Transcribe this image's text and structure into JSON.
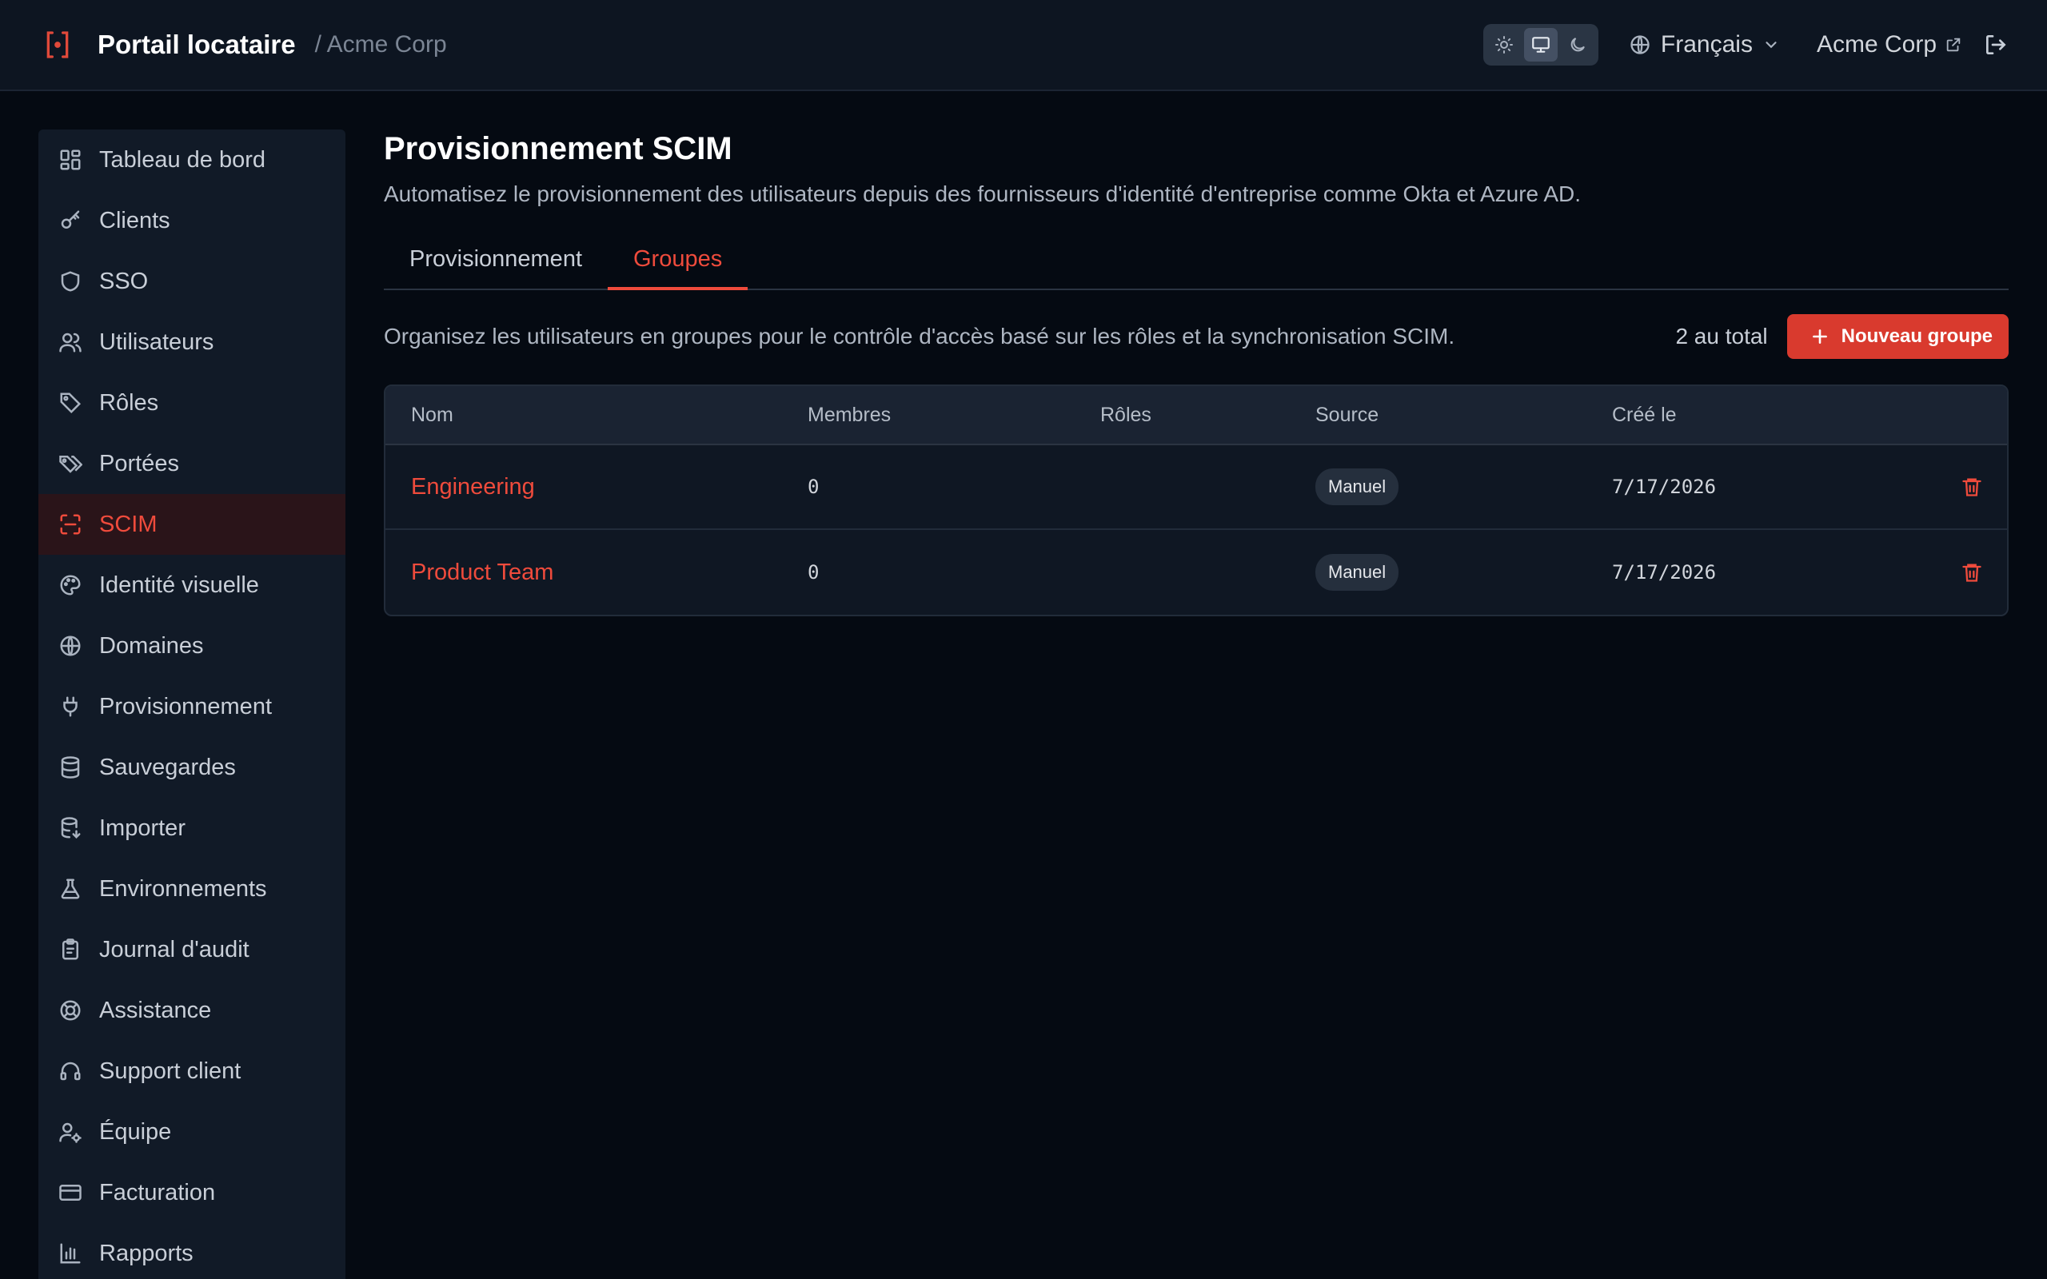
{
  "header": {
    "brand_title": "Portail locataire",
    "breadcrumb": "/ Acme Corp",
    "theme_modes": [
      "light",
      "system",
      "dark"
    ],
    "theme_active": "system",
    "language": "Français",
    "org_name": "Acme Corp"
  },
  "sidebar": {
    "items": [
      {
        "label": "Tableau de bord",
        "icon": "dashboard-icon"
      },
      {
        "label": "Clients",
        "icon": "key-icon"
      },
      {
        "label": "SSO",
        "icon": "shield-icon"
      },
      {
        "label": "Utilisateurs",
        "icon": "users-icon"
      },
      {
        "label": "Rôles",
        "icon": "tag-icon"
      },
      {
        "label": "Portées",
        "icon": "tags-icon"
      },
      {
        "label": "SCIM",
        "icon": "scan-icon",
        "active": true
      },
      {
        "label": "Identité visuelle",
        "icon": "palette-icon"
      },
      {
        "label": "Domaines",
        "icon": "globe-icon"
      },
      {
        "label": "Provisionnement",
        "icon": "plug-icon"
      },
      {
        "label": "Sauvegardes",
        "icon": "database-icon"
      },
      {
        "label": "Importer",
        "icon": "database-import-icon"
      },
      {
        "label": "Environnements",
        "icon": "flask-icon"
      },
      {
        "label": "Journal d'audit",
        "icon": "clipboard-icon"
      },
      {
        "label": "Assistance",
        "icon": "lifebuoy-icon"
      },
      {
        "label": "Support client",
        "icon": "headset-icon"
      },
      {
        "label": "Équipe",
        "icon": "user-cog-icon"
      },
      {
        "label": "Facturation",
        "icon": "credit-card-icon"
      },
      {
        "label": "Rapports",
        "icon": "bar-chart-icon"
      }
    ]
  },
  "main": {
    "title": "Provisionnement SCIM",
    "subtitle": "Automatisez le provisionnement des utilisateurs depuis des fournisseurs d'identité d'entreprise comme Okta et Azure AD.",
    "tabs": [
      {
        "label": "Provisionnement",
        "active": false
      },
      {
        "label": "Groupes",
        "active": true
      }
    ],
    "toolbar": {
      "description": "Organisez les utilisateurs en groupes pour le contrôle d'accès basé sur les rôles et la synchronisation SCIM.",
      "total": "2 au total",
      "new_group_label": "Nouveau groupe"
    },
    "table": {
      "columns": [
        "Nom",
        "Membres",
        "Rôles",
        "Source",
        "Créé le"
      ],
      "rows": [
        {
          "name": "Engineering",
          "members": "0",
          "roles": "",
          "source": "Manuel",
          "created": "7/17/2026"
        },
        {
          "name": "Product Team",
          "members": "0",
          "roles": "",
          "source": "Manuel",
          "created": "7/17/2026"
        }
      ]
    }
  },
  "colors": {
    "accent": "#ef4b3c",
    "background": "#050a12",
    "surface": "#111a27"
  }
}
